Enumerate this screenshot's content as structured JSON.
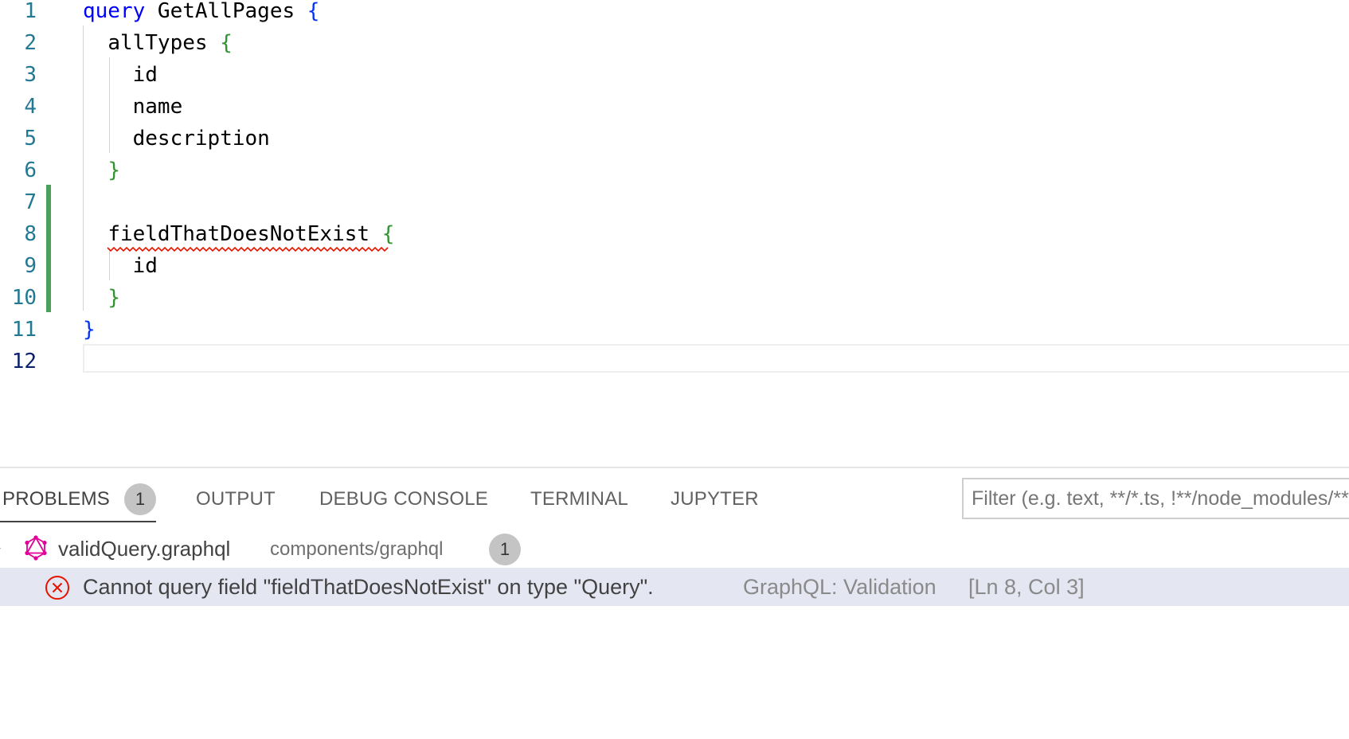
{
  "editor": {
    "lines": [
      {
        "num": "1",
        "indent": "",
        "keyword": "query",
        "text": " GetAllPages ",
        "brace": "{",
        "brace_color": "#0431fa"
      },
      {
        "num": "2",
        "indent": "  ",
        "keyword": "",
        "text": "allTypes ",
        "brace": "{",
        "brace_color": "#319331"
      },
      {
        "num": "3",
        "indent": "    ",
        "keyword": "",
        "text": "id",
        "brace": "",
        "brace_color": ""
      },
      {
        "num": "4",
        "indent": "    ",
        "keyword": "",
        "text": "name",
        "brace": "",
        "brace_color": ""
      },
      {
        "num": "5",
        "indent": "    ",
        "keyword": "",
        "text": "description",
        "brace": "",
        "brace_color": ""
      },
      {
        "num": "6",
        "indent": "  ",
        "keyword": "",
        "text": "",
        "brace": "}",
        "brace_color": "#319331"
      },
      {
        "num": "7",
        "indent": "",
        "keyword": "",
        "text": "",
        "brace": "",
        "brace_color": ""
      },
      {
        "num": "8",
        "indent": "  ",
        "keyword": "",
        "text": "",
        "error_text": "fieldThatDoesNotExist",
        "brace": " {",
        "brace_color": "#319331"
      },
      {
        "num": "9",
        "indent": "    ",
        "keyword": "",
        "text": "id",
        "brace": "",
        "brace_color": ""
      },
      {
        "num": "10",
        "indent": "  ",
        "keyword": "",
        "text": "",
        "brace": "}",
        "brace_color": "#319331"
      },
      {
        "num": "11",
        "indent": "",
        "keyword": "",
        "text": "",
        "brace": "}",
        "brace_color": "#0431fa"
      },
      {
        "num": "12",
        "indent": "",
        "keyword": "",
        "text": "",
        "brace": "",
        "brace_color": ""
      }
    ],
    "active_line": "12"
  },
  "panel": {
    "tabs": [
      {
        "label": "PROBLEMS",
        "badge": "1",
        "active": true
      },
      {
        "label": "OUTPUT"
      },
      {
        "label": "DEBUG CONSOLE"
      },
      {
        "label": "TERMINAL"
      },
      {
        "label": "JUPYTER"
      }
    ],
    "filter_placeholder": "Filter (e.g. text, **/*.ts, !**/node_modules/**)",
    "file": {
      "icon": "graphql-icon",
      "name": "validQuery.graphql",
      "path": "components/graphql",
      "count": "1"
    },
    "problem": {
      "icon": "error-icon",
      "message": "Cannot query field \"fieldThatDoesNotExist\" on type \"Query\".",
      "source": "GraphQL: Validation",
      "location": "[Ln 8, Col 3]"
    }
  },
  "colors": {
    "keyword": "#0000ff",
    "line_number": "#237893",
    "git_added": "#4aa05a",
    "error": "#e51400",
    "graphql_pink": "#e10098",
    "selection_row": "#e4e6f1"
  }
}
